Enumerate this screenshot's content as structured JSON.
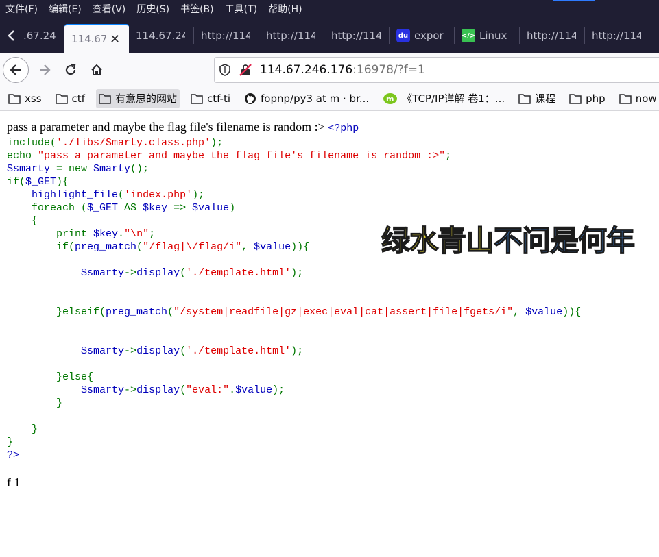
{
  "menu": [
    "文件(F)",
    "编辑(E)",
    "查看(V)",
    "历史(S)",
    "书签(B)",
    "工具(T)",
    "帮助(H)"
  ],
  "tabs": [
    {
      "label": "114.67.24",
      "partial": ".67.24"
    },
    {
      "label": "114.67",
      "active": true
    },
    {
      "label": "114.67.24"
    },
    {
      "label": "http://114"
    },
    {
      "label": "http://114"
    },
    {
      "label": "http://114"
    },
    {
      "label": "expor",
      "icon": "baidu-icon"
    },
    {
      "label": "Linux",
      "icon": "linux-icon"
    },
    {
      "label": "http://114"
    },
    {
      "label": "http://114"
    }
  ],
  "url": {
    "host": "114.67.246.176",
    "rest": ":16978/?f=1"
  },
  "bookmarks": [
    {
      "label": "xss",
      "icon": "folder-icon"
    },
    {
      "label": "ctf",
      "icon": "folder-icon"
    },
    {
      "label": "有意思的网站",
      "icon": "folder-icon",
      "hover": true
    },
    {
      "label": "ctf-ti",
      "icon": "folder-icon"
    },
    {
      "label": "fopnp/py3 at m · br...",
      "icon": "github-icon"
    },
    {
      "label": "《TCP/IP详解 卷1：...",
      "icon": "m-icon"
    },
    {
      "label": "课程",
      "icon": "folder-icon"
    },
    {
      "label": "php",
      "icon": "folder-icon"
    },
    {
      "label": "now",
      "icon": "folder-icon"
    }
  ],
  "page": {
    "intro": "pass a parameter and maybe the flag file's filename is random :>",
    "output": "f 1",
    "code": {
      "open": "<?php",
      "l1a": "include(",
      "l1b": "'./libs/Smarty.class.php'",
      "l1c": ");",
      "l2a": "echo ",
      "l2b": "\"pass a parameter and maybe the flag file's filename is random :>\"",
      "l2c": ";",
      "l3a": "$smarty ",
      "l3b": "= new ",
      "l3c": "Smarty",
      "l3d": "();",
      "l4a": "if(",
      "l4b": "$_GET",
      "l4c": "){",
      "l5a": "highlight_file",
      "l5b": "(",
      "l5c": "'index.php'",
      "l5d": ");",
      "l6a": "foreach (",
      "l6b": "$_GET ",
      "l6c": "AS ",
      "l6d": "$key ",
      "l6e": "=> ",
      "l6f": "$value",
      "l6g": ")",
      "l7": "{",
      "l8a": "print ",
      "l8b": "$key",
      "l8c": ".",
      "l8d": "\"\\n\"",
      "l8e": ";",
      "l9a": "if(",
      "l9b": "preg_match",
      "l9c": "(",
      "l9d": "\"/flag|\\/flag/i\"",
      "l9e": ", ",
      "l9f": "$value",
      "l9g": ")){",
      "l10a": "$smarty",
      "l10b": "->",
      "l10c": "display",
      "l10d": "(",
      "l10e": "'./template.html'",
      "l10f": ");",
      "l11a": "}elseif(",
      "l11b": "preg_match",
      "l11c": "(",
      "l11d": "\"/system|readfile|gz|exec|eval|cat|assert|file|fgets/i\"",
      "l11e": ", ",
      "l11f": "$value",
      "l11g": ")){",
      "l12a": "$smarty",
      "l12b": "->",
      "l12c": "display",
      "l12d": "(",
      "l12e": "'./template.html'",
      "l12f": ");",
      "l13": "}else{",
      "l14a": "$smarty",
      "l14b": "->",
      "l14c": "display",
      "l14d": "(",
      "l14e": "\"eval:\"",
      "l14f": ".",
      "l14g": "$value",
      "l14h": ");",
      "l15": "}",
      "l16": "}",
      "l17": "}",
      "close": "?>"
    }
  },
  "watermark": {
    "part1": "绿水青山",
    "part2": "不问是何年"
  },
  "colors": {
    "keyword": "#007700",
    "default": "#0000bb",
    "string": "#dd0000",
    "chrome": "#1f1e33"
  }
}
